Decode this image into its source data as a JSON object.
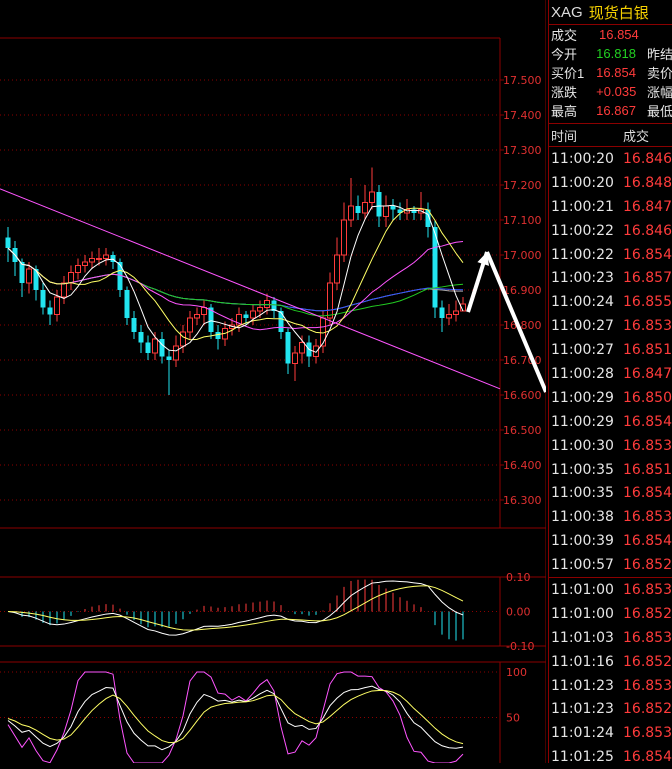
{
  "quote": {
    "symbol": "XAG",
    "name": "现货白银",
    "rows": [
      {
        "label": "成交",
        "value": "16.854",
        "color": "up",
        "extra": ""
      },
      {
        "label": "今开",
        "value": "16.818",
        "color": "down",
        "extra": "昨结"
      },
      {
        "label": "买价1",
        "value": "16.854",
        "color": "up",
        "extra": "卖价"
      },
      {
        "label": "涨跌",
        "value": "+0.035",
        "color": "up",
        "extra": "涨幅"
      },
      {
        "label": "最高",
        "value": "16.867",
        "color": "up",
        "extra": "最低"
      }
    ]
  },
  "ticks": {
    "header_time": "时间",
    "header_price": "成交",
    "rows": [
      {
        "time": "11:00:20",
        "price": "16.846"
      },
      {
        "time": "11:00:20",
        "price": "16.848"
      },
      {
        "time": "11:00:21",
        "price": "16.847"
      },
      {
        "time": "11:00:22",
        "price": "16.846"
      },
      {
        "time": "11:00:22",
        "price": "16.854"
      },
      {
        "time": "11:00:23",
        "price": "16.857"
      },
      {
        "time": "11:00:24",
        "price": "16.855"
      },
      {
        "time": "11:00:27",
        "price": "16.853"
      },
      {
        "time": "11:00:27",
        "price": "16.851"
      },
      {
        "time": "11:00:28",
        "price": "16.847"
      },
      {
        "time": "11:00:29",
        "price": "16.850"
      },
      {
        "time": "11:00:29",
        "price": "16.854"
      },
      {
        "time": "11:00:30",
        "price": "16.853"
      },
      {
        "time": "11:00:35",
        "price": "16.851"
      },
      {
        "time": "11:00:35",
        "price": "16.854"
      },
      {
        "time": "11:00:38",
        "price": "16.853"
      },
      {
        "time": "11:00:39",
        "price": "16.854"
      },
      {
        "time": "11:00:57",
        "price": "16.852"
      },
      {
        "time": "11:01:00",
        "price": "16.853"
      },
      {
        "time": "11:01:00",
        "price": "16.852"
      },
      {
        "time": "11:01:03",
        "price": "16.853"
      },
      {
        "time": "11:01:16",
        "price": "16.852"
      },
      {
        "time": "11:01:23",
        "price": "16.853"
      },
      {
        "time": "11:01:23",
        "price": "16.852"
      },
      {
        "time": "11:01:24",
        "price": "16.853"
      },
      {
        "time": "11:01:25",
        "price": "16.854"
      }
    ]
  },
  "chart_data": [
    {
      "type": "candlestick",
      "title": "",
      "ylim": [
        16.22,
        17.62
      ],
      "yticks": [
        "17.500",
        "17.400",
        "17.300",
        "17.200",
        "17.100",
        "17.000",
        "16.900",
        "16.800",
        "16.700",
        "16.600",
        "16.500",
        "16.400",
        "16.300"
      ],
      "ytick_values": [
        17.5,
        17.4,
        17.3,
        17.2,
        17.1,
        17.0,
        16.9,
        16.8,
        16.7,
        16.6,
        16.5,
        16.4,
        16.3
      ],
      "colors": {
        "up": "#ff3b3b",
        "down": "#22e5f0",
        "ma5": "#ffffff",
        "ma10": "#ffff66",
        "ma20": "#ff55ff",
        "ma40": "#22cc22",
        "ma60": "#aaaaaa",
        "ma120": "#3355ff",
        "trendline": "#ff55ff"
      },
      "closes": [
        17.02,
        16.98,
        16.92,
        16.96,
        16.9,
        16.85,
        16.83,
        16.88,
        16.92,
        16.95,
        16.97,
        16.98,
        16.99,
        16.99,
        17.0,
        16.98,
        16.9,
        16.82,
        16.78,
        16.75,
        16.72,
        16.76,
        16.71,
        16.7,
        16.74,
        16.78,
        16.82,
        16.83,
        16.85,
        16.78,
        16.76,
        16.79,
        16.8,
        16.83,
        16.82,
        16.84,
        16.85,
        16.87,
        16.84,
        16.78,
        16.69,
        16.72,
        16.75,
        16.71,
        16.74,
        16.82,
        16.92,
        17.0,
        17.1,
        17.14,
        17.12,
        17.15,
        17.18,
        17.11,
        17.14,
        17.13,
        17.12,
        17.13,
        17.12,
        17.13,
        17.08,
        16.85,
        16.82,
        16.83,
        16.84,
        16.86
      ],
      "opens": [
        17.05,
        17.02,
        16.98,
        16.92,
        16.96,
        16.9,
        16.85,
        16.83,
        16.88,
        16.92,
        16.95,
        16.97,
        16.98,
        16.99,
        16.99,
        17.0,
        16.98,
        16.9,
        16.82,
        16.78,
        16.75,
        16.72,
        16.76,
        16.71,
        16.7,
        16.74,
        16.78,
        16.82,
        16.83,
        16.85,
        16.78,
        16.76,
        16.79,
        16.8,
        16.83,
        16.82,
        16.84,
        16.85,
        16.87,
        16.84,
        16.78,
        16.69,
        16.72,
        16.75,
        16.71,
        16.74,
        16.82,
        16.92,
        17.0,
        17.1,
        17.14,
        17.12,
        17.15,
        17.18,
        17.11,
        17.14,
        17.13,
        17.12,
        17.13,
        17.12,
        17.13,
        17.08,
        16.85,
        16.82,
        16.83,
        16.84
      ],
      "highs": [
        17.08,
        17.04,
        16.99,
        16.98,
        16.97,
        16.92,
        16.87,
        16.9,
        16.94,
        16.97,
        16.99,
        17.0,
        17.01,
        17.02,
        17.02,
        17.01,
        16.99,
        16.91,
        16.84,
        16.8,
        16.77,
        16.78,
        16.78,
        16.73,
        16.77,
        16.8,
        16.84,
        16.85,
        16.87,
        16.86,
        16.8,
        16.81,
        16.82,
        16.85,
        16.84,
        16.86,
        16.87,
        16.89,
        16.88,
        16.85,
        16.79,
        16.74,
        16.77,
        16.77,
        16.76,
        16.84,
        16.95,
        17.05,
        17.15,
        17.22,
        17.17,
        17.2,
        17.25,
        17.2,
        17.17,
        17.16,
        17.15,
        17.16,
        17.14,
        17.18,
        17.15,
        17.1,
        16.87,
        16.86,
        16.87,
        16.88
      ],
      "lows": [
        16.98,
        16.94,
        16.88,
        16.89,
        16.87,
        16.83,
        16.8,
        16.81,
        16.86,
        16.9,
        16.93,
        16.95,
        16.96,
        16.97,
        16.97,
        16.96,
        16.88,
        16.8,
        16.76,
        16.72,
        16.7,
        16.7,
        16.69,
        16.6,
        16.68,
        16.72,
        16.76,
        16.8,
        16.8,
        16.76,
        16.73,
        16.74,
        16.77,
        16.78,
        16.8,
        16.8,
        16.82,
        16.83,
        16.82,
        16.76,
        16.66,
        16.64,
        16.69,
        16.68,
        16.69,
        16.72,
        16.8,
        16.9,
        16.98,
        17.08,
        17.1,
        17.1,
        17.13,
        17.08,
        17.08,
        17.1,
        17.1,
        17.1,
        17.1,
        17.1,
        17.05,
        16.82,
        16.78,
        16.8,
        16.81,
        16.84
      ],
      "trendline": [
        [
          17.18,
          0
        ],
        [
          16.66,
          65
        ]
      ]
    },
    {
      "type": "macd",
      "ylim": [
        -0.1,
        0.1
      ],
      "yticks": [
        "0.10",
        "0.00",
        "-0.10"
      ],
      "ytick_values": [
        0.1,
        0.0,
        -0.1
      ],
      "colors": {
        "pos": "#ff3b3b",
        "neg": "#22e5f0",
        "dif": "#ffffff",
        "dea": "#ffff66"
      }
    },
    {
      "type": "kdj",
      "ylim": [
        0,
        100
      ],
      "yticks": [
        "100",
        "50"
      ],
      "ytick_values": [
        100,
        50
      ],
      "colors": {
        "k": "#ffffff",
        "d": "#ffff66",
        "j": "#ff55ff"
      }
    }
  ]
}
